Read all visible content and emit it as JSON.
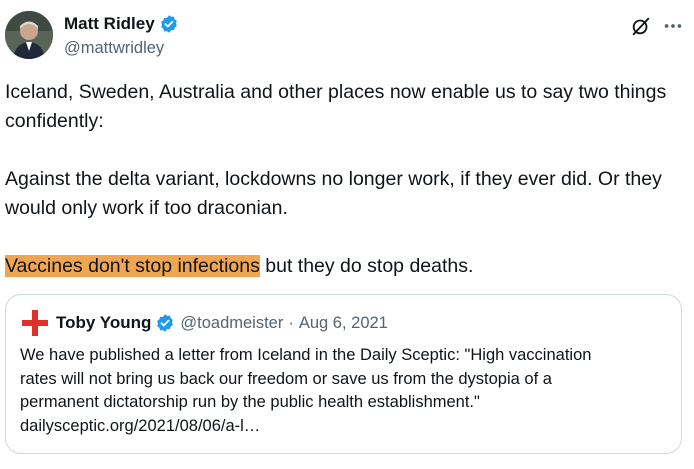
{
  "author": {
    "display_name": "Matt Ridley",
    "handle": "@mattwridley"
  },
  "icons": {
    "verified": "verified-badge-icon",
    "grok": "grok-icon",
    "more": "more-icon"
  },
  "colors": {
    "verified": "#1d9bf0",
    "highlight": "#f0a552",
    "text": "#0f1419",
    "muted": "#536471"
  },
  "body": {
    "para1": "Iceland, Sweden, Australia and other places now enable us to say two things confidently:",
    "para2": "Against the delta variant, lockdowns no longer work, if they ever did. Or they would only work if too draconian.",
    "para3_highlight": "Vaccines don't stop infections",
    "para3_rest": " but they do stop deaths."
  },
  "quote": {
    "display_name": "Toby Young",
    "handle": "@toadmeister",
    "separator": "·",
    "date": "Aug 6, 2021",
    "lines": [
      "We have published a letter from Iceland in the Daily Sceptic: \"High vaccination",
      "rates will not bring us back our freedom or save us from the dystopia of a",
      "permanent dictatorship run by the public health establishment.\"",
      "dailysceptic.org/2021/08/06/a-l…"
    ]
  }
}
